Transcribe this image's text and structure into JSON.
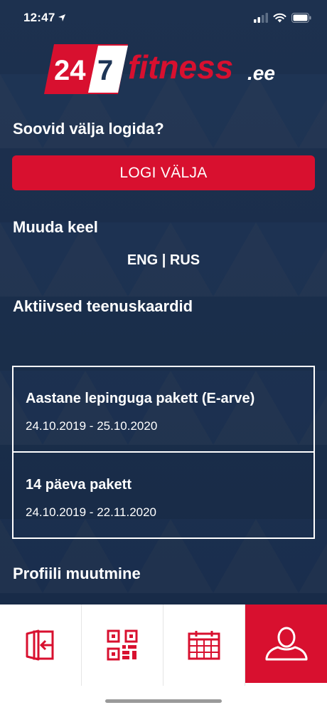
{
  "status": {
    "time": "12:47",
    "icons": [
      "location-arrow-icon",
      "signal-bars-icon",
      "wifi-icon",
      "battery-icon"
    ]
  },
  "logo": {
    "part1": "24",
    "part2": "7",
    "brand": "fitness",
    "suffix": ".ee"
  },
  "logout": {
    "question": "Soovid välja logida?",
    "button_label": "LOGI VÄLJA"
  },
  "language": {
    "title": "Muuda keel",
    "option_eng": "ENG",
    "separator": "|",
    "option_rus": "RUS"
  },
  "service_cards": {
    "title": "Aktiivsed teenuskaardid",
    "items": [
      {
        "name": "Aastane lepinguga pakett (E-arve)",
        "dates": "24.10.2019 - 25.10.2020"
      },
      {
        "name": "14 päeva pakett",
        "dates": "24.10.2019 - 22.11.2020"
      }
    ]
  },
  "profile": {
    "title": "Profiili muutmine"
  },
  "tabbar": {
    "tabs": [
      {
        "icon": "door-enter-icon",
        "active": false
      },
      {
        "icon": "qr-code-icon",
        "active": false
      },
      {
        "icon": "calendar-icon",
        "active": false
      },
      {
        "icon": "user-icon",
        "active": true
      }
    ]
  },
  "colors": {
    "accent": "#d8102f",
    "background": "#1e3556",
    "tabbar": "#ffffff"
  }
}
